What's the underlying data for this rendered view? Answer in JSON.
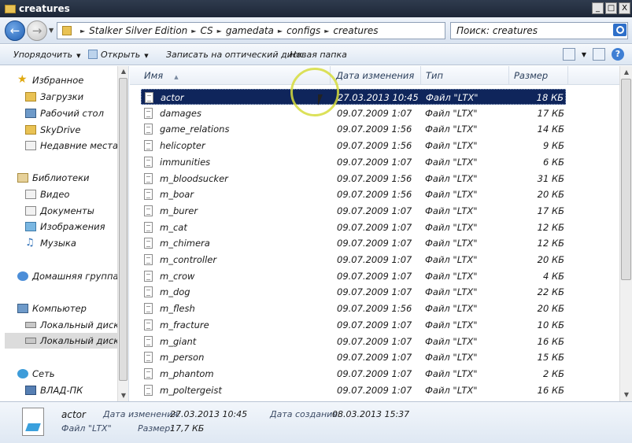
{
  "window": {
    "title": "creatures",
    "min": "_",
    "max": "□",
    "close": "X"
  },
  "address": {
    "crumbs": [
      "Stalker Silver Edition",
      "CS",
      "gamedata",
      "configs",
      "creatures"
    ],
    "search_placeholder": "Поиск: creatures"
  },
  "commands": {
    "organize": "Упорядочить",
    "open": "Открыть",
    "burn": "Записать на оптический диск",
    "new_folder": "Новая папка"
  },
  "nav": {
    "favorites": "Избранное",
    "downloads": "Загрузки",
    "desktop": "Рабочий стол",
    "skydrive": "SkyDrive",
    "recent": "Недавние места",
    "libraries": "Библиотеки",
    "video": "Видео",
    "documents": "Документы",
    "pictures": "Изображения",
    "music": "Музыка",
    "homegroup": "Домашняя группа",
    "computer": "Компьютер",
    "disk1": "Локальный диск",
    "disk2": "Локальный диск",
    "network": "Сеть",
    "pc": "ВЛАД-ПК"
  },
  "columns": {
    "name": "Имя",
    "date": "Дата изменения",
    "type": "Тип",
    "size": "Размер"
  },
  "files": [
    {
      "name": "actor",
      "date": "27.03.2013 10:45",
      "type": "Файл \"LTX\"",
      "size": "18 КБ"
    },
    {
      "name": "damages",
      "date": "09.07.2009 1:07",
      "type": "Файл \"LTX\"",
      "size": "17 КБ"
    },
    {
      "name": "game_relations",
      "date": "09.07.2009 1:56",
      "type": "Файл \"LTX\"",
      "size": "14 КБ"
    },
    {
      "name": "helicopter",
      "date": "09.07.2009 1:56",
      "type": "Файл \"LTX\"",
      "size": "9 КБ"
    },
    {
      "name": "immunities",
      "date": "09.07.2009 1:07",
      "type": "Файл \"LTX\"",
      "size": "6 КБ"
    },
    {
      "name": "m_bloodsucker",
      "date": "09.07.2009 1:56",
      "type": "Файл \"LTX\"",
      "size": "31 КБ"
    },
    {
      "name": "m_boar",
      "date": "09.07.2009 1:56",
      "type": "Файл \"LTX\"",
      "size": "20 КБ"
    },
    {
      "name": "m_burer",
      "date": "09.07.2009 1:07",
      "type": "Файл \"LTX\"",
      "size": "17 КБ"
    },
    {
      "name": "m_cat",
      "date": "09.07.2009 1:07",
      "type": "Файл \"LTX\"",
      "size": "12 КБ"
    },
    {
      "name": "m_chimera",
      "date": "09.07.2009 1:07",
      "type": "Файл \"LTX\"",
      "size": "12 КБ"
    },
    {
      "name": "m_controller",
      "date": "09.07.2009 1:07",
      "type": "Файл \"LTX\"",
      "size": "20 КБ"
    },
    {
      "name": "m_crow",
      "date": "09.07.2009 1:07",
      "type": "Файл \"LTX\"",
      "size": "4 КБ"
    },
    {
      "name": "m_dog",
      "date": "09.07.2009 1:07",
      "type": "Файл \"LTX\"",
      "size": "22 КБ"
    },
    {
      "name": "m_flesh",
      "date": "09.07.2009 1:56",
      "type": "Файл \"LTX\"",
      "size": "20 КБ"
    },
    {
      "name": "m_fracture",
      "date": "09.07.2009 1:07",
      "type": "Файл \"LTX\"",
      "size": "10 КБ"
    },
    {
      "name": "m_giant",
      "date": "09.07.2009 1:07",
      "type": "Файл \"LTX\"",
      "size": "16 КБ"
    },
    {
      "name": "m_person",
      "date": "09.07.2009 1:07",
      "type": "Файл \"LTX\"",
      "size": "15 КБ"
    },
    {
      "name": "m_phantom",
      "date": "09.07.2009 1:07",
      "type": "Файл \"LTX\"",
      "size": "2 КБ"
    },
    {
      "name": "m_poltergeist",
      "date": "09.07.2009 1:07",
      "type": "Файл \"LTX\"",
      "size": "16 КБ"
    }
  ],
  "details": {
    "name": "actor",
    "type": "Файл \"LTX\"",
    "modified_label": "Дата изменения:",
    "modified": "27.03.2013 10:45",
    "created_label": "Дата создания:",
    "created": "08.03.2013 15:37",
    "size_label": "Размер:",
    "size": "17,7 КБ"
  }
}
